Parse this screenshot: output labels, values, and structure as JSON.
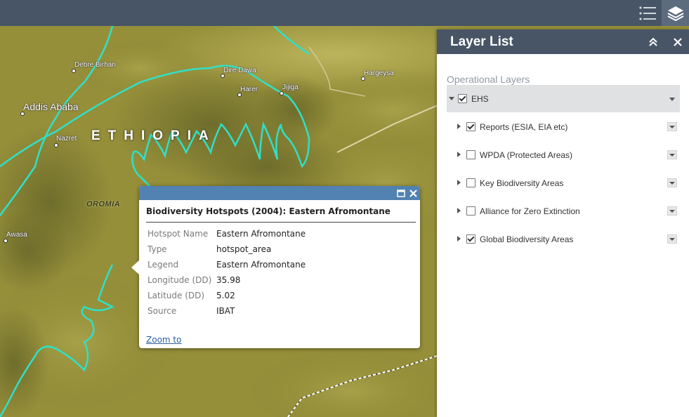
{
  "toolbar": {
    "legend_icon": "legend-list-icon",
    "layers_icon": "layers-icon"
  },
  "map": {
    "country_label": "ETHIOPIA",
    "region_label": "OROMIA",
    "cities": [
      "Debre Birhan",
      "Addis Ababa",
      "Nazret",
      "Dire Dawa",
      "Harer",
      "Jijiga",
      "Hargeysa",
      "Awasa"
    ],
    "boundary_color": "#2fe0c8"
  },
  "panel": {
    "title": "Layer List",
    "section_label": "Operational Layers",
    "group": {
      "label": "EHS",
      "checked": true
    },
    "layers": [
      {
        "label": "Reports (ESIA, EIA etc)",
        "checked": true
      },
      {
        "label": "WPDA (Protected Areas)",
        "checked": false
      },
      {
        "label": "Key Biodiversity Areas",
        "checked": false
      },
      {
        "label": "Alliance for Zero Extinction",
        "checked": false
      },
      {
        "label": "Global Biodiversity Areas",
        "checked": true
      }
    ]
  },
  "popup": {
    "title": "Biodiversity Hotspots (2004): Eastern Afromontane",
    "attributes": [
      {
        "name": "Hotspot Name",
        "value": "Eastern Afromontane"
      },
      {
        "name": "Type",
        "value": "hotspot_area"
      },
      {
        "name": "Legend",
        "value": "Eastern Afromontane"
      },
      {
        "name": "Longitude (DD)",
        "value": "35.98"
      },
      {
        "name": "Latitude (DD)",
        "value": "5.02"
      },
      {
        "name": "Source",
        "value": "IBAT"
      }
    ],
    "zoom_label": "Zoom to"
  },
  "colors": {
    "header": "#485566",
    "popup_bar": "#5182b1",
    "map_base": "#8f8a33"
  }
}
